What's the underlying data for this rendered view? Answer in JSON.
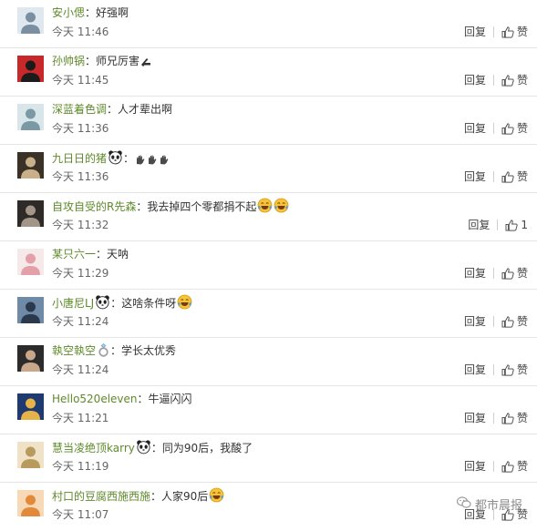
{
  "comments": [
    {
      "name": "安小偲",
      "text": "好强啊",
      "time": "今天 11:46",
      "reply": "回复",
      "like": "赞",
      "emojis": [],
      "avatar": {
        "icon": "avatar-photo-person-white-shirt",
        "bg": "#dfe8ee",
        "fg": "#7b8fa2"
      }
    },
    {
      "name": "孙帅锅",
      "text": "师兄厉害",
      "time": "今天 11:45",
      "reply": "回复",
      "like": "赞",
      "emojis": [
        "pointing-hand"
      ],
      "avatar": {
        "icon": "avatar-panda-red-flag",
        "bg": "#c8282a",
        "fg": "#1b1b1b"
      }
    },
    {
      "name": "深蓝着色调",
      "text": "人才辈出啊",
      "time": "今天 11:36",
      "reply": "回复",
      "like": "赞",
      "emojis": [],
      "avatar": {
        "icon": "avatar-illustration-figure",
        "bg": "#d8e6ea",
        "fg": "#7a99a4"
      }
    },
    {
      "name": "九日日的猪",
      "text": "",
      "time": "今天 11:36",
      "reply": "回复",
      "like": "赞",
      "emojis": [
        "raised-hands",
        "raised-hands",
        "raised-hands"
      ],
      "name_emoji": "panda",
      "avatar": {
        "icon": "avatar-anime-girl",
        "bg": "#3a3226",
        "fg": "#c9b08a"
      }
    },
    {
      "name": "自攻自受的R先森",
      "text": "我去掉四个零都捐不起",
      "time": "今天 11:32",
      "reply": "回复",
      "like": "1",
      "emojis": [
        "laugh-cry",
        "laugh-cry"
      ],
      "avatar": {
        "icon": "avatar-dark-portrait",
        "bg": "#2e2a28",
        "fg": "#a39688"
      }
    },
    {
      "name": "某只六一",
      "text": "天呐",
      "time": "今天 11:29",
      "reply": "回复",
      "like": "赞",
      "emojis": [],
      "avatar": {
        "icon": "avatar-cute-cartoon",
        "bg": "#f6e9ea",
        "fg": "#e3a0a8"
      }
    },
    {
      "name": "小唐尼LJ",
      "text": "这啥条件呀",
      "time": "今天 11:24",
      "reply": "回复",
      "like": "赞",
      "emojis": [
        "laugh-cry"
      ],
      "name_emoji": "panda",
      "avatar": {
        "icon": "avatar-seascape",
        "bg": "#6f8aa6",
        "fg": "#2a3a4c"
      }
    },
    {
      "name": "執空執空",
      "text": "学长太优秀",
      "time": "今天 11:24",
      "reply": "回复",
      "like": "赞",
      "emojis": [],
      "name_emoji": "ring",
      "avatar": {
        "icon": "avatar-man-in-suit",
        "bg": "#2b2b2b",
        "fg": "#c9a78a"
      }
    },
    {
      "name": "Hello520eleven",
      "text": "牛逼闪闪",
      "time": "今天 11:21",
      "reply": "回复",
      "like": "赞",
      "emojis": [],
      "avatar": {
        "icon": "avatar-night-palace",
        "bg": "#1e3a6e",
        "fg": "#e6b24a"
      }
    },
    {
      "name": "慧当凌绝顶karry",
      "text": "同为90后，我酸了",
      "time": "今天 11:19",
      "reply": "回复",
      "like": "赞",
      "emojis": [],
      "name_emoji": "panda",
      "avatar": {
        "icon": "avatar-blonde-portrait",
        "bg": "#efe2c6",
        "fg": "#b99a5e"
      }
    },
    {
      "name": "村口的豆腐西施西施",
      "text": "人家90后",
      "time": "今天 11:07",
      "reply": "回复",
      "like": "赞",
      "emojis": [
        "laugh-cry"
      ],
      "avatar": {
        "icon": "avatar-orange-flower",
        "bg": "#f7d9b8",
        "fg": "#e28a3a"
      }
    }
  ],
  "separator": "：",
  "watermark": {
    "text": "都市晨报",
    "icon": "wechat-icon"
  },
  "colors": {
    "name": "#5e8a2a",
    "text": "#333333",
    "meta": "#666666",
    "divider": "#e4e4e4"
  }
}
